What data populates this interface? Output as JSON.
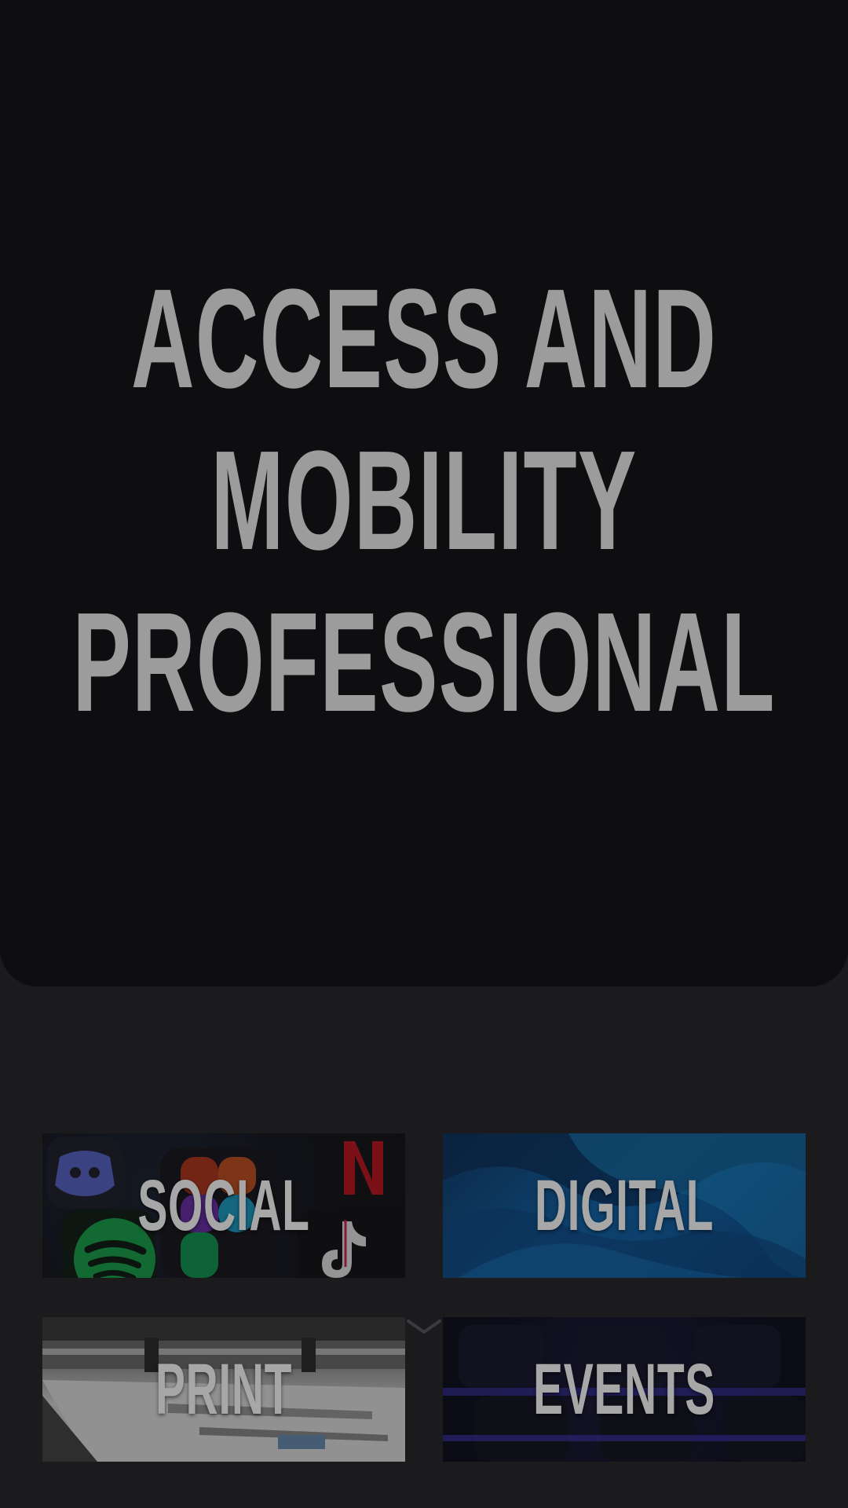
{
  "hero": {
    "title_lines": [
      "ACCESS AND",
      "MOBILITY",
      "PROFESSIONAL"
    ]
  },
  "tiles": [
    {
      "label": "SOCIAL",
      "image": "social-apps-image"
    },
    {
      "label": "DIGITAL",
      "image": "blue-abstract-waves-image"
    },
    {
      "label": "PRINT",
      "image": "printing-press-image"
    },
    {
      "label": "EVENTS",
      "image": "auditorium-seats-image"
    }
  ],
  "scroll_cue": {
    "icon": "chevron-down-icon"
  },
  "colors": {
    "hero_background": "#0e0e11",
    "page_background": "#1b1b1d",
    "title_text": "#9c9c9c",
    "tile_label": "#a7a7a7"
  }
}
